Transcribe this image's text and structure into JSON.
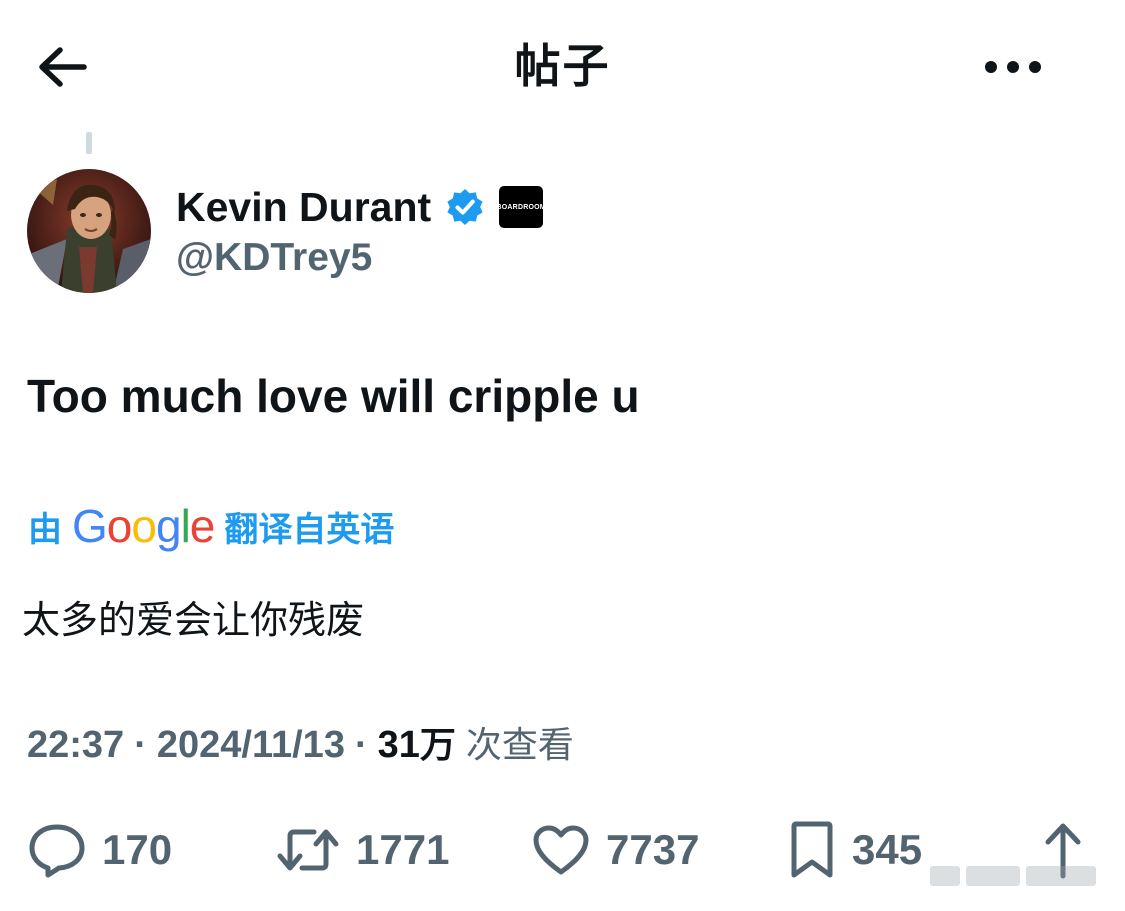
{
  "header": {
    "title": "帖子",
    "back_icon": "arrow-left-icon",
    "more_icon": "more-horizontal-icon"
  },
  "author": {
    "display_name": "Kevin Durant",
    "handle": "@KDTrey5",
    "verified": true,
    "verified_color": "#1d9bf0",
    "affiliate_badge_text": "BOARDROOM"
  },
  "tweet": {
    "text": "Too much love will cripple u",
    "translation_prefix": "由",
    "translation_provider": "Google",
    "translation_suffix": "翻译自英语",
    "translated_text": "太多的爱会让你残废"
  },
  "meta": {
    "time": "22:37",
    "separator": "·",
    "date": "2024/11/13",
    "views_count": "31",
    "views_unit": "万",
    "views_label": "次查看"
  },
  "actions": {
    "reply_count": "170",
    "retweet_count": "1771",
    "like_count": "7737",
    "bookmark_count": "345"
  },
  "colors": {
    "text_primary": "#0f1419",
    "text_secondary": "#536471",
    "accent": "#1d9bf0"
  }
}
